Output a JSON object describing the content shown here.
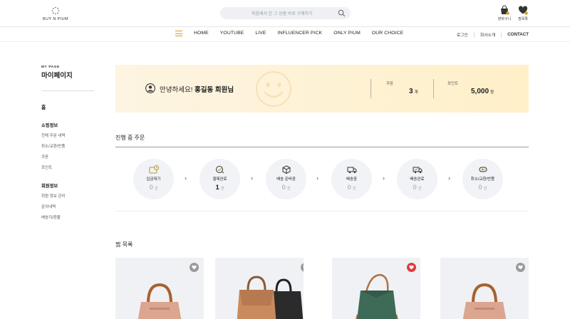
{
  "header": {
    "logo_text": "BUY N PIUM",
    "search_placeholder": "피움에서 본 그 상품 바로 구매하기",
    "icons": [
      {
        "name": "shopping-bag-icon",
        "label": "장바구니"
      },
      {
        "name": "heart-icon",
        "label": "찜목록"
      }
    ]
  },
  "nav": {
    "items": [
      "HOME",
      "YOUTUBE",
      "LIVE",
      "INFLUENCER PICK",
      "ONLY PIUM",
      "OUR CHOICE"
    ],
    "util": [
      "로그인",
      "회사소개",
      "CONTACT"
    ]
  },
  "sidebar": {
    "small_title": "MY PAGE",
    "title": "마이페이지",
    "home": "홈",
    "shopping_title": "쇼핑정보",
    "shopping_items": [
      "전체 주문 내역",
      "취소/교환/반품",
      "쿠폰",
      "포인트"
    ],
    "member_title": "회원정보",
    "member_items": [
      "회원 정보 관리",
      "문의내역",
      "배송지/환불"
    ]
  },
  "banner": {
    "greeting": "안녕하세요!",
    "user_name": "홍길동 회원님",
    "coupon_label": "쿠폰",
    "coupon_value": "3",
    "coupon_unit": "개",
    "point_label": "포인트",
    "point_value": "5,000",
    "point_unit": "원"
  },
  "orders": {
    "title": "진행 중 주문",
    "count_unit": "건",
    "steps": [
      {
        "label": "입금대기",
        "count": "0",
        "icon": "payment-wait-icon"
      },
      {
        "label": "결제완료",
        "count": "1",
        "icon": "payment-done-icon"
      },
      {
        "label": "배송 준비중",
        "count": "0",
        "icon": "box-icon"
      },
      {
        "label": "배송중",
        "count": "0",
        "icon": "truck-icon"
      },
      {
        "label": "배송완료",
        "count": "0",
        "icon": "truck-check-icon"
      },
      {
        "label": "취소/교환/반품",
        "count": "0",
        "icon": "return-icon"
      }
    ]
  },
  "wishlist": {
    "title": "찜 목록",
    "items": [
      {
        "liked": false,
        "color": "#d9a58d"
      },
      {
        "liked": false,
        "color": "#c98a5e"
      },
      {
        "liked": true,
        "color": "#3d6b58"
      },
      {
        "liked": false,
        "color": "#d9a58d"
      }
    ]
  },
  "colors": {
    "accent": "#c9a227",
    "banner": "#fdf0cf",
    "heart_active": "#e03c3c"
  }
}
